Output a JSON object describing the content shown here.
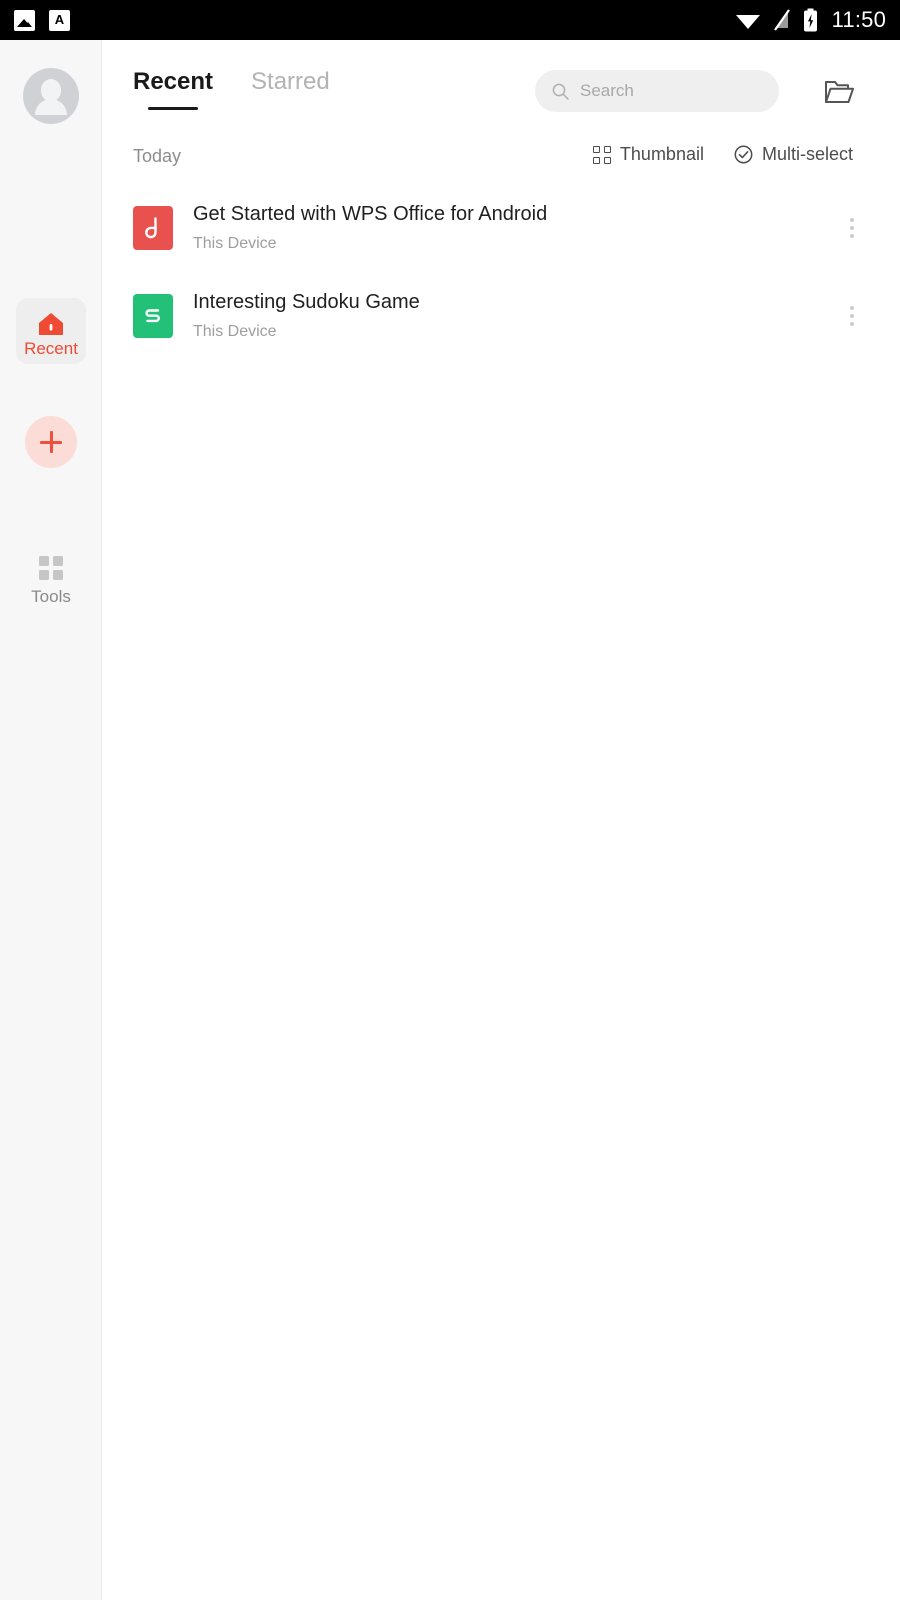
{
  "status_bar": {
    "left_icons": [
      {
        "name": "photo-icon",
        "label": "Photo"
      },
      {
        "name": "text-a-icon",
        "label": "A"
      }
    ],
    "right_icons": [
      {
        "name": "wifi-icon",
        "label": "Wi-Fi"
      },
      {
        "name": "signal-off-icon",
        "label": "No signal"
      },
      {
        "name": "battery-charging-icon",
        "label": "Charging"
      }
    ],
    "time": "11:50",
    "background_color": "#000000",
    "foreground_color": "#ffffff"
  },
  "sidebar": {
    "background_color": "#f7f7f7",
    "avatar": {
      "icon": "user-avatar-icon",
      "label": "Account"
    },
    "items": [
      {
        "icon": "home-icon",
        "label": "Recent",
        "active": true,
        "color": "#ee4a34"
      },
      {
        "icon": "plus-icon",
        "label": "",
        "active": false,
        "color": "#ef503b"
      },
      {
        "icon": "apps-grid-icon",
        "label": "Tools",
        "active": false,
        "color": "#8a8a8a"
      }
    ]
  },
  "appbar": {
    "tabs": [
      {
        "label": "Recent",
        "active": true
      },
      {
        "label": "Starred",
        "active": false
      }
    ],
    "search": {
      "icon": "search-icon",
      "placeholder": "Search",
      "value": ""
    },
    "folder_button": {
      "icon": "folder-icon",
      "label": "Open folder"
    }
  },
  "section": {
    "title": "Today",
    "actions": [
      {
        "icon": "thumbnail-grid-icon",
        "label": "Thumbnail"
      },
      {
        "icon": "check-circle-icon",
        "label": "Multi-select"
      }
    ]
  },
  "files": [
    {
      "title": "Get Started with WPS Office for Android",
      "subtitle": "This Device",
      "icon": "pdf-file-icon",
      "icon_type": "pdf",
      "icon_color": "#e8514d",
      "glyph": "P",
      "more_label": "More options"
    },
    {
      "title": "Interesting Sudoku Game",
      "subtitle": "This Device",
      "icon": "spreadsheet-file-icon",
      "icon_type": "sheet",
      "icon_color": "#23c178",
      "glyph": "S",
      "more_label": "More options"
    }
  ],
  "theme": {
    "accent": "#ee4a34",
    "page_background": "#ffffff",
    "sidebar_background": "#f7f7f7",
    "search_background": "#efefef",
    "active_tab_underline": "#1a1a1a"
  }
}
